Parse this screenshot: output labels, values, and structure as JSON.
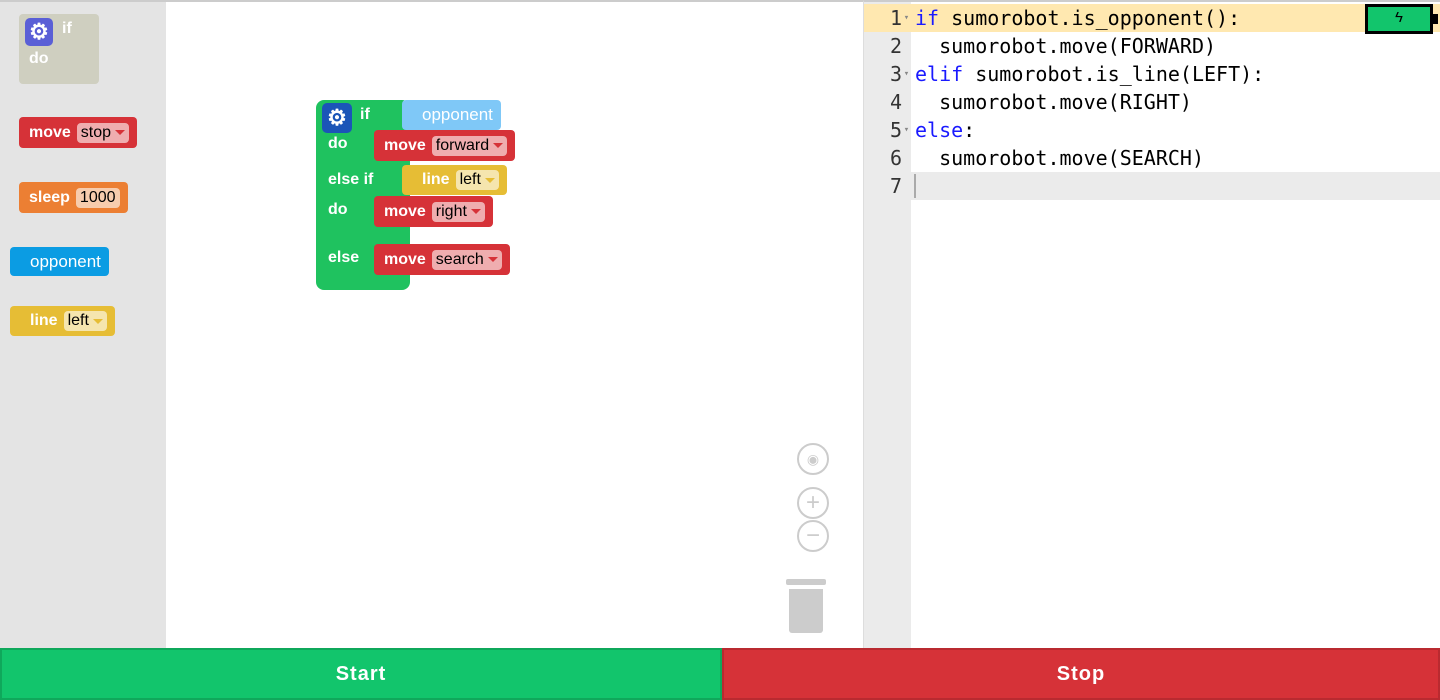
{
  "toolbox": {
    "if_block": {
      "if": "if",
      "do": "do"
    },
    "move": {
      "label": "move",
      "value": "stop"
    },
    "sleep": {
      "label": "sleep",
      "value": "1000"
    },
    "opponent": {
      "label": "opponent"
    },
    "line": {
      "label": "line",
      "value": "left"
    }
  },
  "workspace": {
    "if": "if",
    "do1": "do",
    "elseif": "else if",
    "do2": "do",
    "else": "else",
    "opponent": "opponent",
    "move1": {
      "label": "move",
      "value": "forward"
    },
    "line": {
      "label": "line",
      "value": "left"
    },
    "move2": {
      "label": "move",
      "value": "right"
    },
    "move3": {
      "label": "move",
      "value": "search"
    }
  },
  "editor": {
    "lines": [
      {
        "n": "1",
        "kw": "if",
        "rest": " sumorobot.is_opponent():"
      },
      {
        "n": "2",
        "kw": "",
        "rest": "  sumorobot.move(FORWARD)"
      },
      {
        "n": "3",
        "kw": "elif",
        "rest": " sumorobot.is_line(LEFT):"
      },
      {
        "n": "4",
        "kw": "",
        "rest": "  sumorobot.move(RIGHT)"
      },
      {
        "n": "5",
        "kw": "else",
        "rest": ":"
      },
      {
        "n": "6",
        "kw": "",
        "rest": "  sumorobot.move(SEARCH)"
      },
      {
        "n": "7",
        "kw": "",
        "rest": ""
      }
    ]
  },
  "battery": {
    "level": "full",
    "color": "#12c56c"
  },
  "buttons": {
    "start": "Start",
    "stop": "Stop"
  },
  "colors": {
    "start": "#12c56c",
    "stop": "#d63238",
    "if_block": "#1fc25f"
  }
}
